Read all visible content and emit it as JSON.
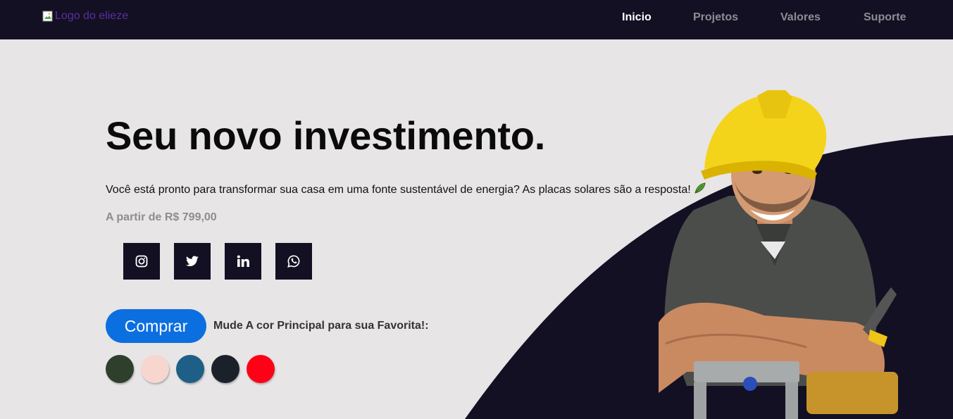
{
  "header": {
    "logo_alt": "Logo do elieze",
    "nav": [
      {
        "label": "Inicio",
        "active": true
      },
      {
        "label": "Projetos",
        "active": false
      },
      {
        "label": "Valores",
        "active": false
      },
      {
        "label": "Suporte",
        "active": false
      }
    ]
  },
  "hero": {
    "title": "Seu novo investimento.",
    "subtitle": "Você está pronto para transformar sua casa em uma fonte sustentável de energia? As placas solares são a resposta!",
    "price": "A partir de R$ 799,00",
    "social": [
      {
        "icon": "instagram-icon"
      },
      {
        "icon": "twitter-icon"
      },
      {
        "icon": "linkedin-icon"
      },
      {
        "icon": "whatsapp-icon"
      }
    ],
    "buy_label": "Comprar",
    "color_label": "Mude A cor Principal para sua Favorita!:",
    "swatches": [
      "#2e3f2c",
      "#f7d6d0",
      "#1d5f86",
      "#1a212b",
      "#ff0016"
    ]
  },
  "colors": {
    "topbar": "#131023",
    "background": "#e7e5e6",
    "accent": "#0c6fe0",
    "wave": "#131023"
  }
}
